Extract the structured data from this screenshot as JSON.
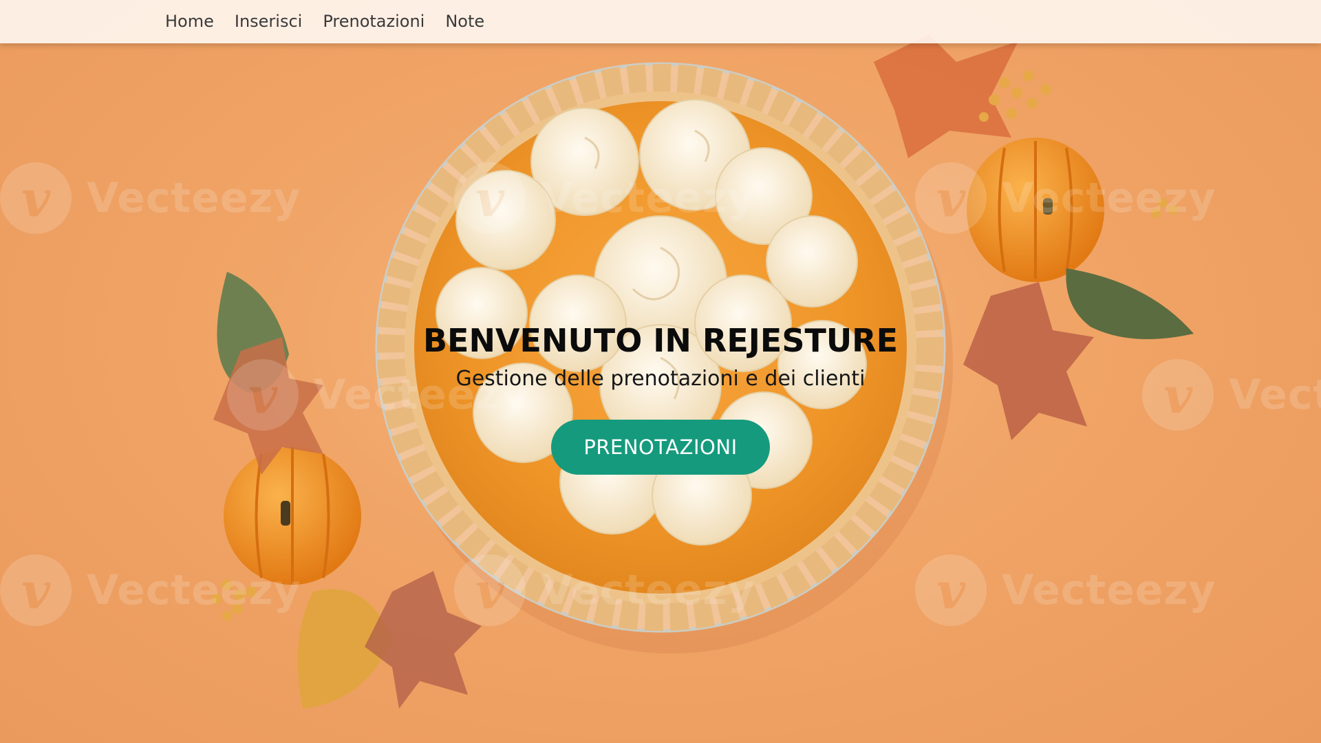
{
  "nav": {
    "items": [
      {
        "label": "Home"
      },
      {
        "label": "Inserisci"
      },
      {
        "label": "Prenotazioni"
      },
      {
        "label": "Note"
      }
    ]
  },
  "hero": {
    "title": "BENVENUTO IN REJESTURE",
    "subtitle": "Gestione delle prenotazioni e dei clienti",
    "cta_label": "PRENOTAZIONI",
    "background_image": "pumpkin-pie-with-whipped-cream-image",
    "watermark_text": "Vecteezy",
    "watermark_logo_glyph": "v"
  },
  "colors": {
    "accent": "#159a7d",
    "background": "#f0a466",
    "nav_bg": "#fff7f2",
    "title": "#0b0b0b"
  }
}
